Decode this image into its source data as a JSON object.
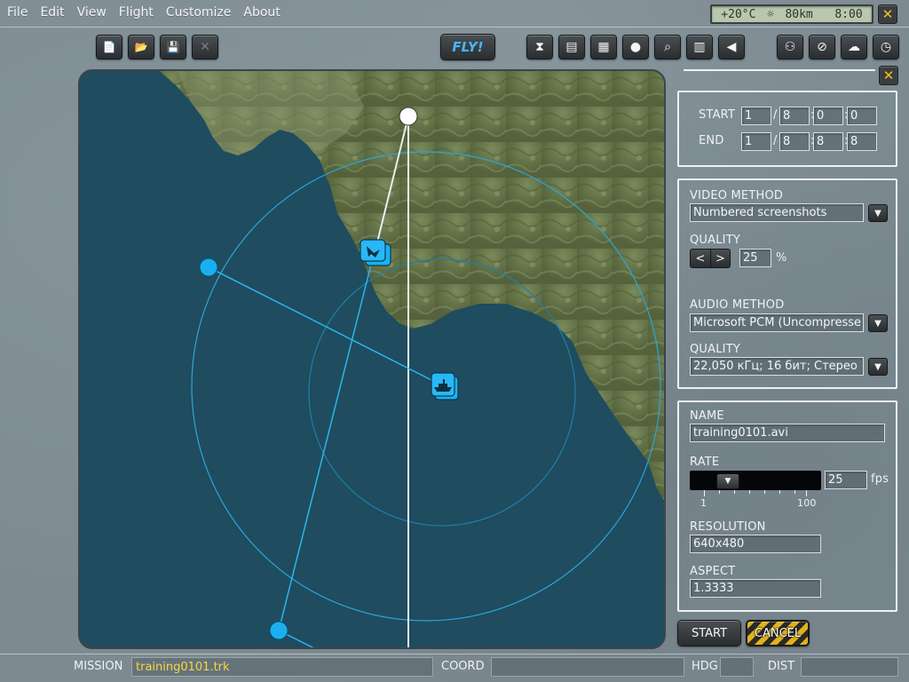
{
  "menu": [
    "File",
    "Edit",
    "View",
    "Flight",
    "Customize",
    "About"
  ],
  "status": {
    "temperature": "+20°C",
    "weather_icon": "sun-icon",
    "visibility": "80km",
    "time": "8:00"
  },
  "close_label": "✕",
  "toolbar": {
    "left": [
      {
        "name": "new-file",
        "glyph": "📄"
      },
      {
        "name": "open-folder",
        "glyph": "📂"
      },
      {
        "name": "save",
        "glyph": "💾"
      },
      {
        "name": "close-mission",
        "glyph": "✕"
      }
    ],
    "fly_label": "FLY!",
    "middle": [
      {
        "name": "hourglass",
        "glyph": "⧗"
      },
      {
        "name": "notes",
        "glyph": "▤"
      },
      {
        "name": "clipboard",
        "glyph": "▦"
      },
      {
        "name": "pilot-head",
        "glyph": "●"
      },
      {
        "name": "zoom",
        "glyph": "⌕"
      },
      {
        "name": "book",
        "glyph": "▥"
      },
      {
        "name": "speaker",
        "glyph": "◀"
      }
    ],
    "right": [
      {
        "name": "binoculars",
        "glyph": "⚇"
      },
      {
        "name": "no-entry",
        "glyph": "⊘"
      },
      {
        "name": "weather",
        "glyph": "☁"
      },
      {
        "name": "clock",
        "glyph": "◷"
      }
    ]
  },
  "time_panel": {
    "start_label": "START",
    "end_label": "END",
    "start": [
      "1",
      "8",
      "0",
      "0"
    ],
    "end": [
      "1",
      "8",
      "8",
      "8"
    ],
    "sep_date": "/",
    "sep_time": ":"
  },
  "av_panel": {
    "video_method_label": "VIDEO METHOD",
    "video_method": "Numbered screenshots",
    "quality_label": "QUALITY",
    "quality_value": "25",
    "quality_unit": "%",
    "audio_method_label": "AUDIO METHOD",
    "audio_method": "Microsoft PCM (Uncompresse",
    "audio_quality_label": "QUALITY",
    "audio_quality": "22,050 кГц; 16 бит; Стерео"
  },
  "file_panel": {
    "name_label": "NAME",
    "name_value": "training0101.avi",
    "rate_label": "RATE",
    "rate_value": "25",
    "rate_unit": "fps",
    "rate_min": "1",
    "rate_max": "100",
    "resolution_label": "RESOLUTION",
    "resolution_value": "640x480",
    "aspect_label": "ASPECT",
    "aspect_value": "1.3333"
  },
  "buttons": {
    "start": "START",
    "cancel": "CANCEL"
  },
  "bottom": {
    "mission_label": "MISSION",
    "mission_value": "training0101.trk",
    "coord_label": "COORD",
    "coord_value": "",
    "hdg_label": "HDG",
    "hdg_value": "",
    "dist_label": "DIST",
    "dist_value": ""
  },
  "colors": {
    "accent_blue": "#1ab0f0",
    "mission_text": "#f5d742",
    "fly_text": "#49b6ff"
  }
}
